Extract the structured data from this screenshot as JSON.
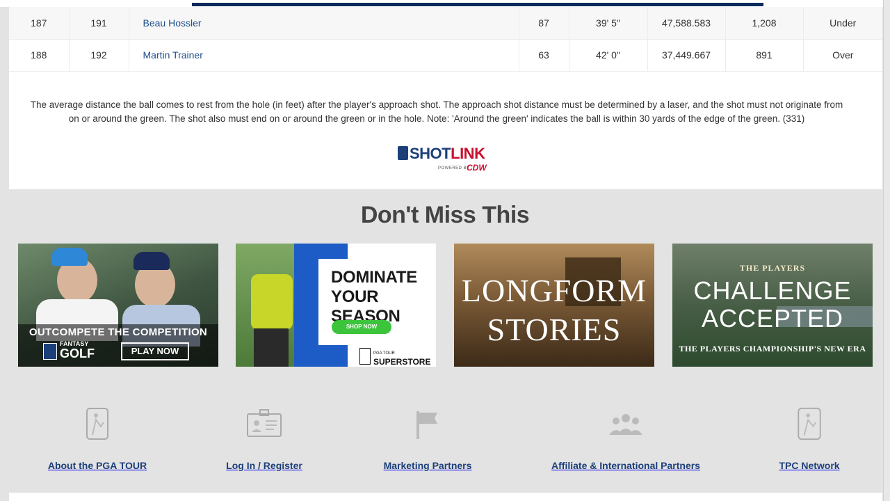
{
  "table": {
    "rows": [
      {
        "rank_this_week": "187",
        "rank_last_week": "191",
        "player": "Beau Hossler",
        "rounds": "87",
        "average": "39' 5\"",
        "total_distance": "47,588.583",
        "attempts": "1,208",
        "relative": "Under"
      },
      {
        "rank_this_week": "188",
        "rank_last_week": "192",
        "player": "Martin Trainer",
        "rounds": "63",
        "average": "42' 0\"",
        "total_distance": "37,449.667",
        "attempts": "891",
        "relative": "Over"
      }
    ]
  },
  "description": "The average distance the ball comes to rest from the hole (in feet) after the player's approach shot. The approach shot distance must be determined by a laser, and the shot must not originate from on or around the green. The shot also must end on or around the green or in the hole. Note: 'Around the green' indicates the ball is within 30 yards of the edge of the green. (331)",
  "shotlink": {
    "shot": "SHOT",
    "link": "LINK",
    "powered": "POWERED BY",
    "cdw": "CDW"
  },
  "section_title": "Don't Miss This",
  "promos": {
    "fantasy": {
      "headline": "OUTCOMPETE THE COMPETITION",
      "brand_small": "FANTASY",
      "brand": "GOLF",
      "cta": "PLAY NOW"
    },
    "superstore": {
      "headline": "DOMINATE YOUR SEASON",
      "cta": "SHOP NOW",
      "brand_small": "PGA TOUR",
      "brand": "SUPERSTORE"
    },
    "longform": {
      "line1": "LONGFORM",
      "line2": "STORIES"
    },
    "players": {
      "brand": "THE PLAYERS",
      "line1": "CHALLENGE",
      "line2": "ACCEPTED",
      "tagline": "THE PLAYERS CHAMPIONSHIP'S NEW ERA"
    }
  },
  "footer": {
    "items": [
      {
        "label": "About the PGA TOUR",
        "icon": "pga-tour-logo-icon"
      },
      {
        "label": "Log In / Register",
        "icon": "id-card-icon"
      },
      {
        "label": "Marketing Partners",
        "icon": "flag-icon"
      },
      {
        "label": "Affiliate & International Partners",
        "icon": "people-group-icon"
      },
      {
        "label": "TPC Network",
        "icon": "pga-tour-logo-icon"
      }
    ]
  },
  "colors": {
    "link": "#1f4f8a",
    "footer_label": "#1c3f7a",
    "accent_red": "#c8102e",
    "nav_bar": "#0a2a5c"
  }
}
